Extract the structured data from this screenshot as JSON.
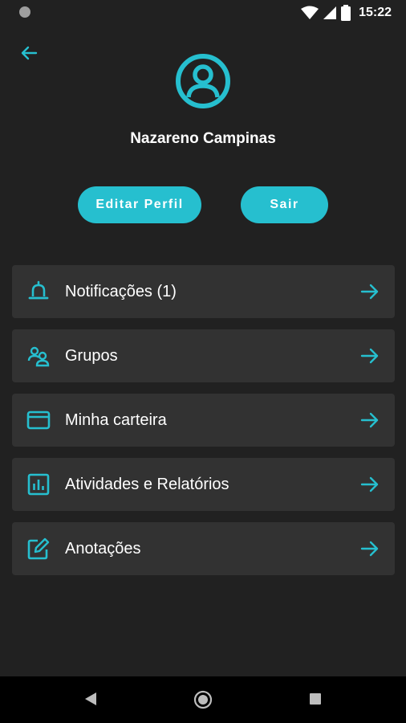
{
  "status_bar": {
    "time": "15:22"
  },
  "profile": {
    "name": "Nazareno Campinas"
  },
  "actions": {
    "edit_label": "Editar Perfil",
    "logout_label": "Sair"
  },
  "menu": [
    {
      "label": "Notificações (1)",
      "icon": "bell-icon"
    },
    {
      "label": "Grupos",
      "icon": "users-icon"
    },
    {
      "label": "Minha carteira",
      "icon": "credit-card-icon"
    },
    {
      "label": "Atividades e Relatórios",
      "icon": "bar-chart-icon"
    },
    {
      "label": "Anotações",
      "icon": "edit-note-icon"
    }
  ],
  "colors": {
    "accent": "#26bfcf",
    "background": "#212121",
    "card": "#323232"
  }
}
